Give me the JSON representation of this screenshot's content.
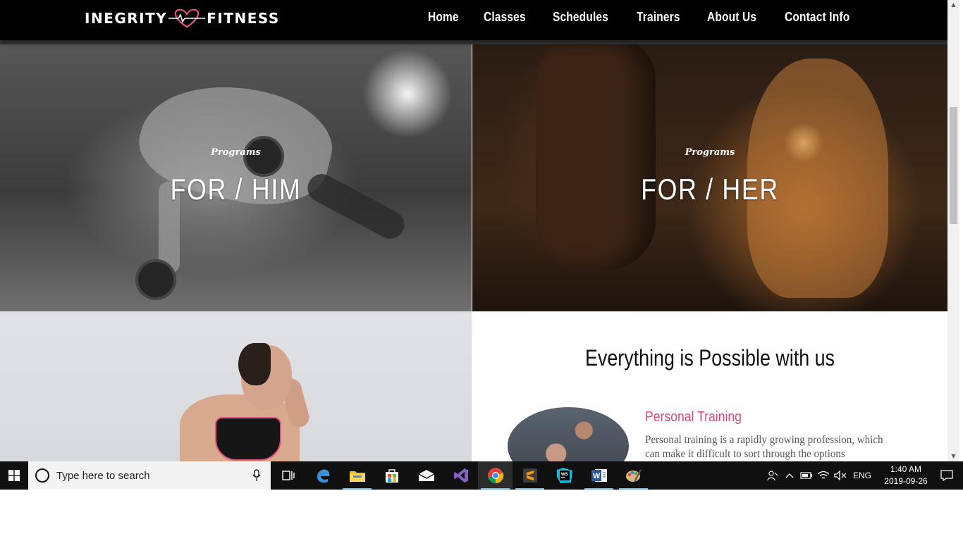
{
  "header": {
    "logo_left": "INEGRITY",
    "logo_right": "FITNESS",
    "nav": [
      "Home",
      "Classes",
      "Schedules",
      "Trainers",
      "About Us",
      "Contact Info"
    ]
  },
  "programs": [
    {
      "subtitle": "Programs",
      "title": "FOR / HIM"
    },
    {
      "subtitle": "Programs",
      "title": "FOR / HER"
    }
  ],
  "section": {
    "title": "Everything is Possible with us",
    "service_title": "Personal Training",
    "service_desc": "Personal training is a rapidly growing profession, which can make it difficult to sort through the options"
  },
  "taskbar": {
    "search_placeholder": "Type here to search",
    "language": "ENG",
    "time": "1:40 AM",
    "date": "2019-09-26",
    "apps": [
      "task-view-icon",
      "edge-browser-icon",
      "file-explorer-icon",
      "store-icon",
      "mail-icon",
      "visual-studio-icon",
      "chrome-icon",
      "sublime-text-icon",
      "webstorm-icon",
      "word-icon",
      "paint-icon"
    ]
  },
  "colors": {
    "accent": "#d14c7d",
    "navbar": "#000000",
    "taskbar": "#101010"
  }
}
